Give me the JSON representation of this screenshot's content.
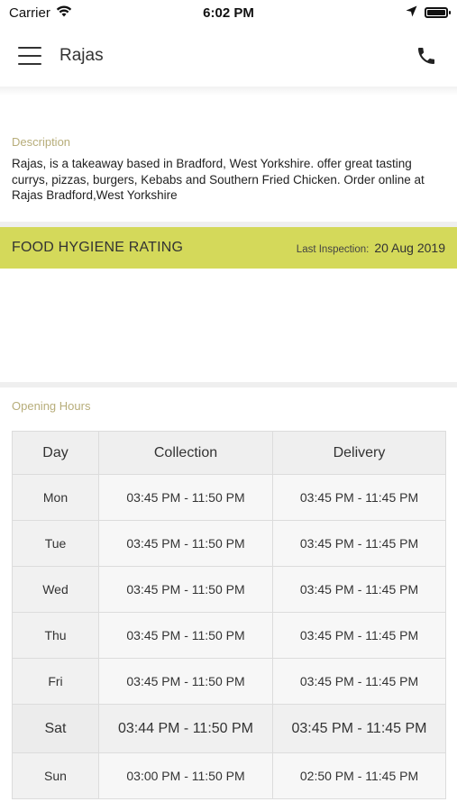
{
  "status_bar": {
    "carrier": "Carrier",
    "time": "6:02 PM"
  },
  "header": {
    "title": "Rajas"
  },
  "description": {
    "label": "Description",
    "text": "Rajas, is a takeaway based in Bradford, West Yorkshire. offer great tasting currys, pizzas, burgers, Kebabs and Southern Fried Chicken. Order online at Rajas Bradford,West Yorkshire"
  },
  "hygiene": {
    "title": "FOOD HYGIENE RATING",
    "last_inspection_label": "Last Inspection:",
    "last_inspection_date": "20 Aug 2019",
    "band_color": "#d4d95a"
  },
  "opening_hours": {
    "label": "Opening Hours",
    "columns": [
      "Day",
      "Collection",
      "Delivery"
    ],
    "rows": [
      {
        "day": "Mon",
        "collection": "03:45 PM - 11:50 PM",
        "delivery": "03:45 PM - 11:45 PM"
      },
      {
        "day": "Tue",
        "collection": "03:45 PM - 11:50 PM",
        "delivery": "03:45 PM - 11:45 PM"
      },
      {
        "day": "Wed",
        "collection": "03:45 PM - 11:50 PM",
        "delivery": "03:45 PM - 11:45 PM"
      },
      {
        "day": "Thu",
        "collection": "03:45 PM - 11:50 PM",
        "delivery": "03:45 PM - 11:45 PM"
      },
      {
        "day": "Fri",
        "collection": "03:45 PM - 11:50 PM",
        "delivery": "03:45 PM - 11:45 PM"
      },
      {
        "day": "Sat",
        "collection": "03:44 PM - 11:50 PM",
        "delivery": "03:45 PM - 11:45 PM"
      },
      {
        "day": "Sun",
        "collection": "03:00 PM - 11:50 PM",
        "delivery": "02:50 PM - 11:45 PM"
      }
    ]
  },
  "icons": {
    "menu": "hamburger-menu-icon",
    "phone": "phone-icon",
    "wifi": "wifi-icon",
    "location": "location-arrow-icon",
    "battery": "battery-icon"
  }
}
